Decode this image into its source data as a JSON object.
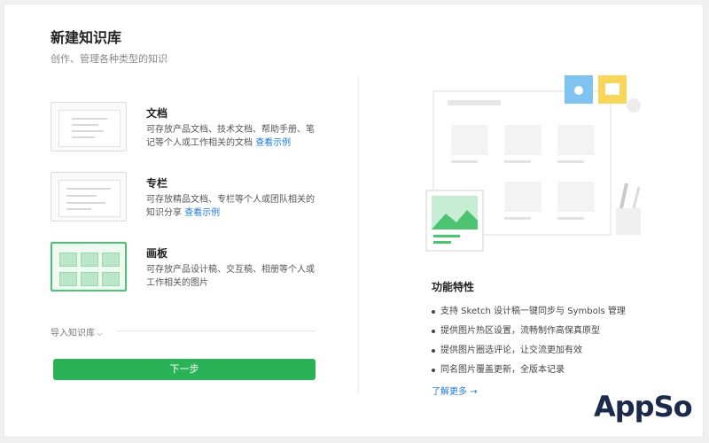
{
  "dialog": {
    "title": "新建知识库",
    "subtitle": "创作、管理各种类型的知识"
  },
  "options": [
    {
      "title": "文档",
      "desc": "可存放产品文档、技术文档、帮助手册、笔记等个人或工作相关的文档",
      "link": "查看示例",
      "selected": false
    },
    {
      "title": "专栏",
      "desc": "可存放精品文档、专栏等个人或团队相关的知识分享",
      "link": "查看示例",
      "selected": false
    },
    {
      "title": "画板",
      "desc": "可存放产品设计稿、交互稿、相册等个人或工作相关的图片",
      "link": "",
      "selected": true
    }
  ],
  "import": {
    "label": "导入知识库",
    "icon": "chevron-down-icon"
  },
  "next_button": "下一步",
  "features": {
    "title": "功能特性",
    "items": [
      "支持 Sketch 设计稿一键同步与 Symbols 管理",
      "提供图片热区设置，流畅制作高保真原型",
      "提供图片圈选评论，让交流更加有效",
      "同名图片覆盖更新，全版本记录"
    ],
    "more_link": "了解更多 →"
  },
  "watermark": "AppSo",
  "colors": {
    "primary_green": "#29b356",
    "link_blue": "#1e7ad9",
    "selected_border": "#4cc370",
    "camera_icon_bg": "#7fc3f0",
    "image_icon_bg": "#f7d65a"
  }
}
